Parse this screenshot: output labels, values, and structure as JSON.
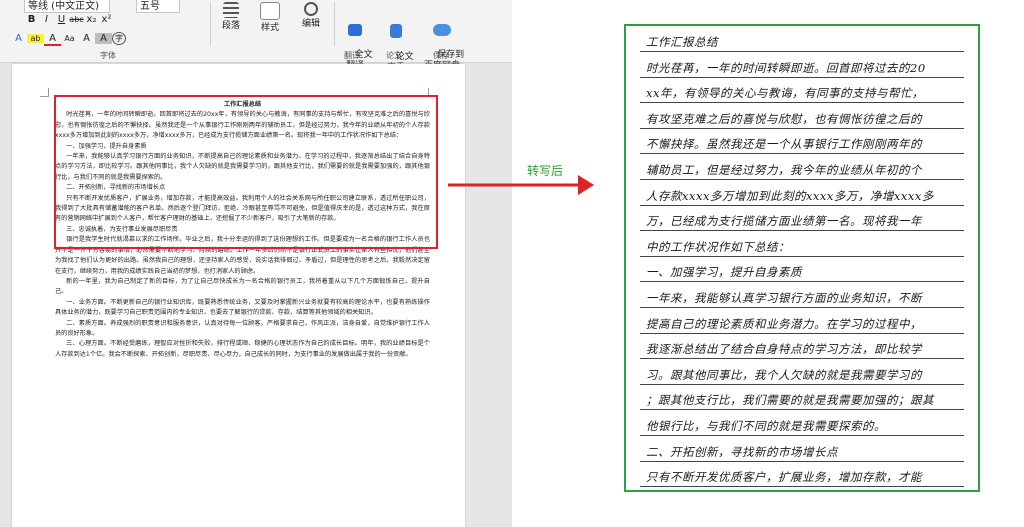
{
  "ribbon": {
    "font_name": "等线 (中文正文)",
    "font_size": "五号",
    "format_buttons": [
      "B",
      "I",
      "U",
      "abc",
      "x₂",
      "x²"
    ],
    "format_buttons2": [
      "A",
      "ab",
      "A",
      "Aa",
      "A",
      "A",
      "字"
    ],
    "group_font": "字体",
    "paragraph": "段落",
    "styles": "样式",
    "edit": "编辑",
    "translate_full": "全文\n翻译",
    "paper_check": "论文\n查重",
    "save_baidu": "保存到\n百度网盘",
    "group_translate": "翻译",
    "group_paper": "论文",
    "group_save": "保存"
  },
  "colors": {
    "red_box": "#d9252a",
    "green_box": "#2f9e44",
    "arrow": "#d9252a",
    "arrow_label": "#2e9e3a"
  },
  "arrow_label": "转写后",
  "document": {
    "title": "工作汇报总结",
    "paragraphs": [
      "时光荏苒，一年的时间转瞬即逝。回首即将过去的20xx年，有领导的关心与教诲，有同事的支持与帮忙，有攻坚克难之后的喜悦与欣慰，也有惆怅彷徨之后的不懈抉择。虽然我还是一个从事银行工作刚刚两年的辅助员工，但是经过努力，我今年的业绩从年初的个人存款xxxx多万增加到此刻的xxxx多万，净增xxxx多万，已经成为支行揽储方面业绩第一名。现将我一年中的工作状况作如下总结：",
      "一、加强学习，提升自身素质",
      "一年来，我能够认真学习银行方面的业务知识，不断提高自己的理论素质和业务潜力。在学习的过程中，我逐渐总结出了结合自身特点的学习方法，即比较学习。跟其他同事比，我个人欠缺的就是我需要学习的，跟其他支行比，我们需要的就是我需要加强的，跟其他银行比，与我们不同的就是我需要探索的。",
      "二、开拓创新，寻找新的市场增长点",
      "只有不断开发优质客户，扩展业务，增加存款，才能提高效益。我利用个人的社会关系网与所任职公司建立联系，透过所任职公司，我得到了大批具有储蓄潜能的客户名单。然后逐个登门拜访，拒绝、冷眼甚至辱骂不可避免，但是值得庆幸的是，透过这种方式，我在原有的营销网络中扩展到个人客户，帮忙客户理财的基础上，还挖掘了不少新客户，吸引了大笔新的存款。",
      "三、忠诚执着，为支行事业发展尽职尽责",
      "银行是我学生时代就渴慕以求的工作场所。毕业之后，我十分幸运的得到了这份理想的工作。但是要成为一名合格的银行工作人员也并不是一件十分容易的事情，必然需要不断地学习、持续的磨练。工作一年多后仍然不是银行正式员工的事实让家人有些担忧，他们甚至为我找了他们认为更好的出路。虽然我自己的理想，还坚持家人的感受，说实话我徘徊过、矛盾过，但是理性的思考之后，我毅然决定留在支行，继续努力，用我的成绩实践自己当初的梦想，也打消家人的顾虑。",
      "新的一年里，我为自己制定了新的目标，为了让自己尽快成长为一名合格的银行员工，我将着重从以下几个方面锻炼自己，提升自己。",
      "一、业务方面。不断更新自己的银行业知识库，既要熟悉传统业务，又要及时掌握新兴业务就要有较高的理论水平，也要有熟练操作具体业务的潜力，既要学习自己职责范围内的专业知识，也要去了解银行的贷款、存款、结算等其他领域的相关知识。",
      "二、素质方面。养成强烈的职责意识和服务意识，认真对待每一位顾客。严格要求自己，作风正派，洁身自爱，自觉维护银行工作人员的良好形象。",
      "三、心理方面。不断经受磨练，理智应对挫折和失败，排行程或顺、稳健的心理状态作为自己的成长目标。明年，我的业绩目标是个人存款到达1个亿。我会不断探索、开拓创新，尽职尽责、尽心尽力，自己成长的同时，为支行事业的发展做出属于我的一份贡献。"
    ]
  },
  "handwritten": {
    "lines": [
      "工作汇报总结",
      "时光荏苒，一年的时间转瞬即逝。回首即将过去的20",
      "xx年，有领导的关心与教诲，有同事的支持与帮忙，",
      "有攻坚克难之后的喜悦与欣慰，也有惆怅彷徨之后的",
      "不懈抉择。虽然我还是一个从事银行工作刚刚两年的",
      "辅助员工，但是经过努力，我今年的业绩从年初的个",
      "人存款xxxx多万增加到此刻的xxxx多万，净增xxxx多",
      "万，已经成为支行揽储方面业绩第一名。现将我一年",
      "中的工作状况作如下总结：",
      "一、加强学习，提升自身素质",
      "一年来，我能够认真学习银行方面的业务知识，不断",
      "提高自己的理论素质和业务潜力。在学习的过程中，",
      "我逐渐总结出了结合自身特点的学习方法，即比较学",
      "习。跟其他同事比，我个人欠缺的就是我需要学习的",
      "；跟其他支行比，我们需要的就是我需要加强的；跟其",
      "他银行比，与我们不同的就是我需要探索的。",
      "二、开拓创新，寻找新的市场增长点",
      "只有不断开发优质客户，扩展业务，增加存款，才能"
    ]
  }
}
